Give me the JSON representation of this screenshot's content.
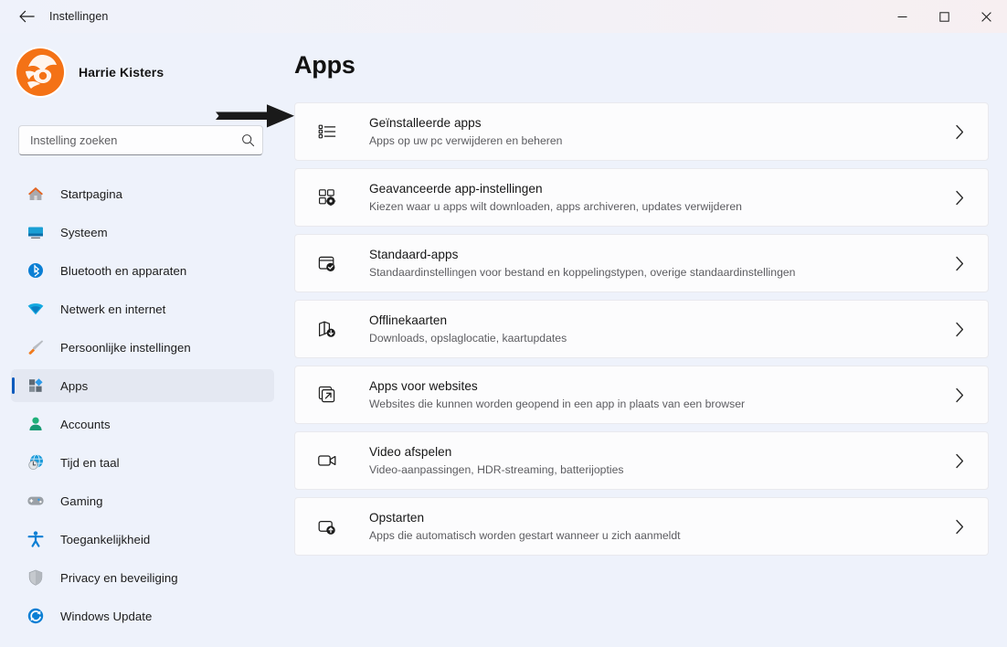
{
  "window": {
    "title": "Instellingen",
    "back_label": "←",
    "controls": {
      "minimize": "—",
      "maximize": "□",
      "close": "✕"
    }
  },
  "sidebar": {
    "profile": {
      "name": "Harrie Kisters",
      "avatar_name": "user-avatar"
    },
    "search": {
      "placeholder": "Instelling zoeken",
      "value": "",
      "icon": "search-icon"
    },
    "items": [
      {
        "label": "Startpagina",
        "icon": "home-icon",
        "selected": false
      },
      {
        "label": "Systeem",
        "icon": "system-icon",
        "selected": false
      },
      {
        "label": "Bluetooth en apparaten",
        "icon": "bluetooth-icon",
        "selected": false
      },
      {
        "label": "Netwerk en internet",
        "icon": "wifi-icon",
        "selected": false
      },
      {
        "label": "Persoonlijke instellingen",
        "icon": "brush-icon",
        "selected": false
      },
      {
        "label": "Apps",
        "icon": "apps-icon",
        "selected": true
      },
      {
        "label": "Accounts",
        "icon": "account-icon",
        "selected": false
      },
      {
        "label": "Tijd en taal",
        "icon": "clock-globe-icon",
        "selected": false
      },
      {
        "label": "Gaming",
        "icon": "gamepad-icon",
        "selected": false
      },
      {
        "label": "Toegankelijkheid",
        "icon": "accessibility-icon",
        "selected": false
      },
      {
        "label": "Privacy en beveiliging",
        "icon": "shield-icon",
        "selected": false
      },
      {
        "label": "Windows Update",
        "icon": "update-icon",
        "selected": false
      }
    ]
  },
  "main": {
    "page_title": "Apps",
    "cards": [
      {
        "title": "Geïnstalleerde apps",
        "subtitle": "Apps op uw pc verwijderen en beheren",
        "icon": "list-icon",
        "chevron": "chevron-right-icon"
      },
      {
        "title": "Geavanceerde app-instellingen",
        "subtitle": "Kiezen waar u apps wilt downloaden, apps archiveren, updates verwijderen",
        "icon": "app-settings-icon",
        "chevron": "chevron-right-icon"
      },
      {
        "title": "Standaard-apps",
        "subtitle": "Standaardinstellingen voor bestand en koppelingstypen, overige standaardinstellingen",
        "icon": "default-apps-icon",
        "chevron": "chevron-right-icon"
      },
      {
        "title": "Offlinekaarten",
        "subtitle": "Downloads, opslaglocatie, kaartupdates",
        "icon": "map-download-icon",
        "chevron": "chevron-right-icon"
      },
      {
        "title": "Apps voor websites",
        "subtitle": "Websites die kunnen worden geopend in een app in plaats van een browser",
        "icon": "external-link-icon",
        "chevron": "chevron-right-icon"
      },
      {
        "title": "Video afspelen",
        "subtitle": "Video-aanpassingen, HDR-streaming, batterijopties",
        "icon": "video-icon",
        "chevron": "chevron-right-icon"
      },
      {
        "title": "Opstarten",
        "subtitle": "Apps die automatisch worden gestart wanneer u zich aanmeldt",
        "icon": "startup-icon",
        "chevron": "chevron-right-icon"
      }
    ]
  },
  "annotation": {
    "arrow": "right-arrow-annotation",
    "color": "#1a1a1a"
  },
  "colors": {
    "page_background": "#eef2fb",
    "card_background": "#fcfcfd",
    "accent": "#0d5bbd",
    "selected_nav": "#e4e8f2",
    "avatar_orange": "#f07010"
  }
}
